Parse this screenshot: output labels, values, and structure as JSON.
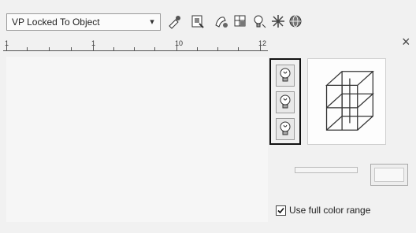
{
  "toolbar": {
    "viewport_select": {
      "value": "VP Locked To Object"
    },
    "buttons": [
      {
        "name": "lock-viewport-icon"
      },
      {
        "name": "viewport-frame-icon"
      },
      {
        "name": "paint-layer-icon"
      },
      {
        "name": "layer-grid-icon"
      },
      {
        "name": "lightbulb-icon"
      },
      {
        "name": "freeze-layer-icon"
      },
      {
        "name": "globe-icon"
      }
    ]
  },
  "ruler": {
    "labels": [
      "1",
      "1",
      "10",
      "12"
    ]
  },
  "panel": {
    "close_label": "×",
    "bulb_buttons": [
      {
        "name": "bulb-on-button"
      },
      {
        "name": "bulb-off-button"
      },
      {
        "name": "bulb-toggle-button"
      }
    ],
    "use_full_color": {
      "label": "Use full color range",
      "checked": true
    }
  }
}
